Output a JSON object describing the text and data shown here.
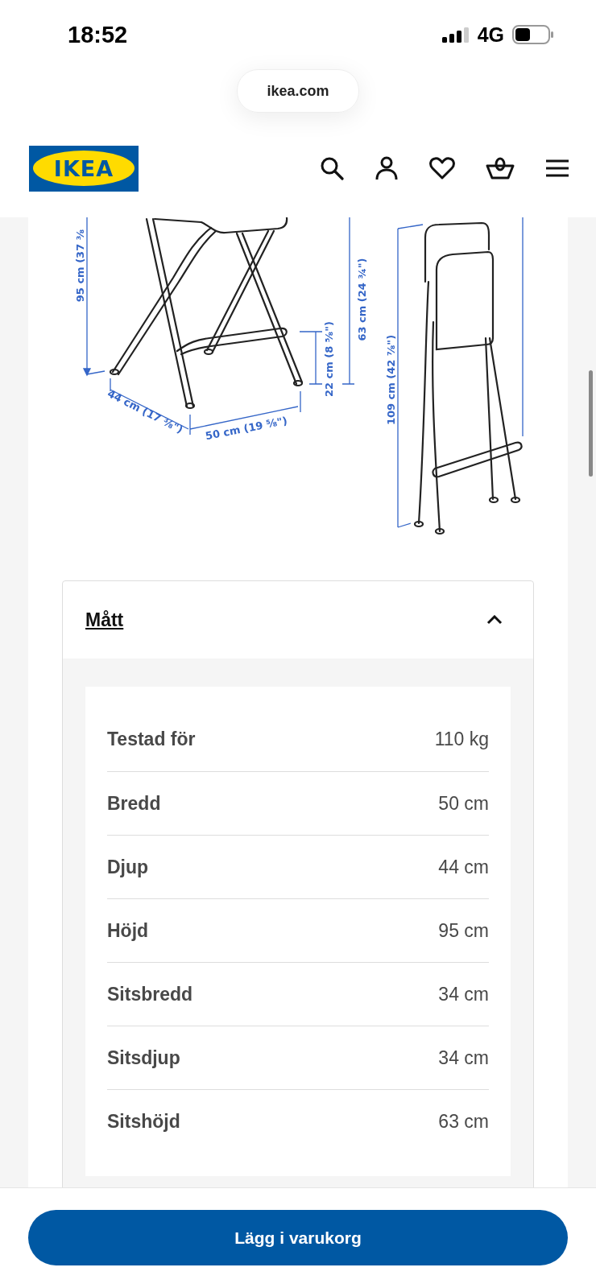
{
  "status_bar": {
    "time": "18:52",
    "network": "4G"
  },
  "browser": {
    "url": "ikea.com"
  },
  "header": {
    "logo": "IKEA"
  },
  "product_drawing": {
    "labels": [
      {
        "kind": "height",
        "text": "95 cm (37 ⅜"
      },
      {
        "kind": "depth",
        "text": "44 cm (17 ⅜\")"
      },
      {
        "kind": "width",
        "text": "50 cm (19 ⅝\")"
      },
      {
        "kind": "footrest",
        "text": "22 cm (8 ⅝\")"
      },
      {
        "kind": "seat",
        "text": "63 cm (24 ¾\")"
      },
      {
        "kind": "folded",
        "text": "109 cm (42 ⅞\")"
      }
    ]
  },
  "accordion": {
    "title": "Mått",
    "expanded": true,
    "rows": [
      {
        "label": "Testad för",
        "value": "110 kg"
      },
      {
        "label": "Bredd",
        "value": "50 cm"
      },
      {
        "label": "Djup",
        "value": "44 cm"
      },
      {
        "label": "Höjd",
        "value": "95 cm"
      },
      {
        "label": "Sitsbredd",
        "value": "34 cm"
      },
      {
        "label": "Sitsdjup",
        "value": "34 cm"
      },
      {
        "label": "Sitshöjd",
        "value": "63 cm"
      }
    ]
  },
  "cart_button": {
    "label": "Lägg i varukorg"
  }
}
